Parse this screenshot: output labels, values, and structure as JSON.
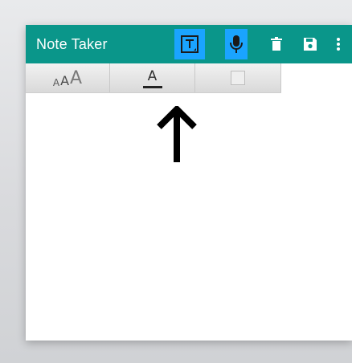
{
  "app": {
    "title": "Note Taker"
  },
  "toolbar": {
    "background": "#0a968a",
    "highlight": "#1aa4ff",
    "icons": [
      "text-mode-icon",
      "mic-icon",
      "delete-icon",
      "save-icon",
      "more-vert-icon"
    ]
  },
  "format_bar": {
    "font_size_glyphs": [
      "A",
      "A",
      "A"
    ],
    "text_color_letter": "A"
  }
}
